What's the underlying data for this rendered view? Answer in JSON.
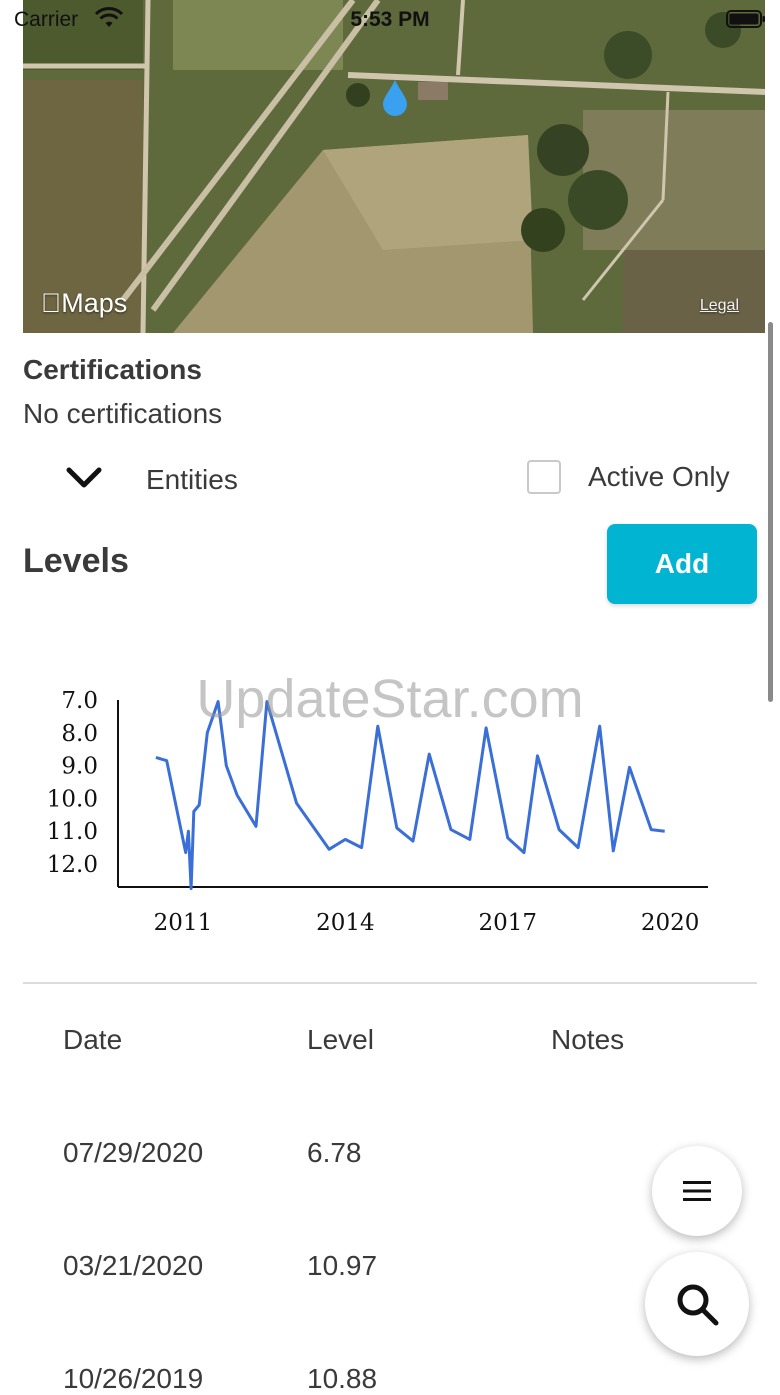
{
  "status_bar": {
    "carrier": "Carrier",
    "time": "5:53 PM"
  },
  "map": {
    "brand": "Maps",
    "legal": "Legal",
    "marker_icon": "water-drop-icon"
  },
  "certifications": {
    "title": "Certifications",
    "value": "No certifications"
  },
  "entities": {
    "label": "Entities",
    "active_only_label": "Active Only",
    "active_only_checked": false
  },
  "levels": {
    "title": "Levels",
    "add_label": "Add",
    "accent_color": "#00b4d2"
  },
  "watermark": "UpdateStar.com",
  "chart_data": {
    "type": "line",
    "title": "",
    "xlabel": "",
    "ylabel": "",
    "y_inverted": true,
    "xlim": [
      2009.8,
      2020.7
    ],
    "ylim": [
      7.0,
      12.7
    ],
    "x_ticks": [
      2011,
      2014,
      2017,
      2020
    ],
    "x_tick_labels": [
      "2011",
      "2014",
      "2017",
      "2020"
    ],
    "y_ticks": [
      7,
      8,
      9,
      10,
      11,
      12
    ],
    "y_tick_labels": [
      "7.0",
      "8.0",
      "9.0",
      "10.0",
      "11.0",
      "12.0"
    ],
    "line_color": "#3a6fd8",
    "series": [
      {
        "x": [
          2010.5,
          2010.7,
          2011.05,
          2011.1,
          2011.15,
          2011.2,
          2011.3,
          2011.45,
          2011.65,
          2011.8,
          2012.0,
          2012.35,
          2012.55,
          2013.1,
          2013.7,
          2014.0,
          2014.3,
          2014.6,
          2014.95,
          2015.25,
          2015.55,
          2015.95,
          2016.3,
          2016.6,
          2017.0,
          2017.3,
          2017.55,
          2017.95,
          2018.3,
          2018.7,
          2018.95,
          2019.25,
          2019.65,
          2019.9
        ],
        "y": [
          8.75,
          8.85,
          11.65,
          11.0,
          12.75,
          10.4,
          10.2,
          8.0,
          7.05,
          9.0,
          9.9,
          10.85,
          7.05,
          10.15,
          11.55,
          11.25,
          11.5,
          7.8,
          10.9,
          11.3,
          8.65,
          10.95,
          11.25,
          7.85,
          11.2,
          11.65,
          8.7,
          10.95,
          11.5,
          7.8,
          11.6,
          9.05,
          10.95,
          11.0
        ],
        "name": ""
      }
    ]
  },
  "table": {
    "headers": [
      "Date",
      "Level",
      "Notes"
    ],
    "rows": [
      {
        "date": "07/29/2020",
        "level": "6.78",
        "notes": ""
      },
      {
        "date": "03/21/2020",
        "level": "10.97",
        "notes": ""
      },
      {
        "date": "10/26/2019",
        "level": "10.88",
        "notes": ""
      }
    ]
  },
  "fabs": {
    "menu_icon": "hamburger-menu-icon",
    "search_icon": "search-icon"
  }
}
